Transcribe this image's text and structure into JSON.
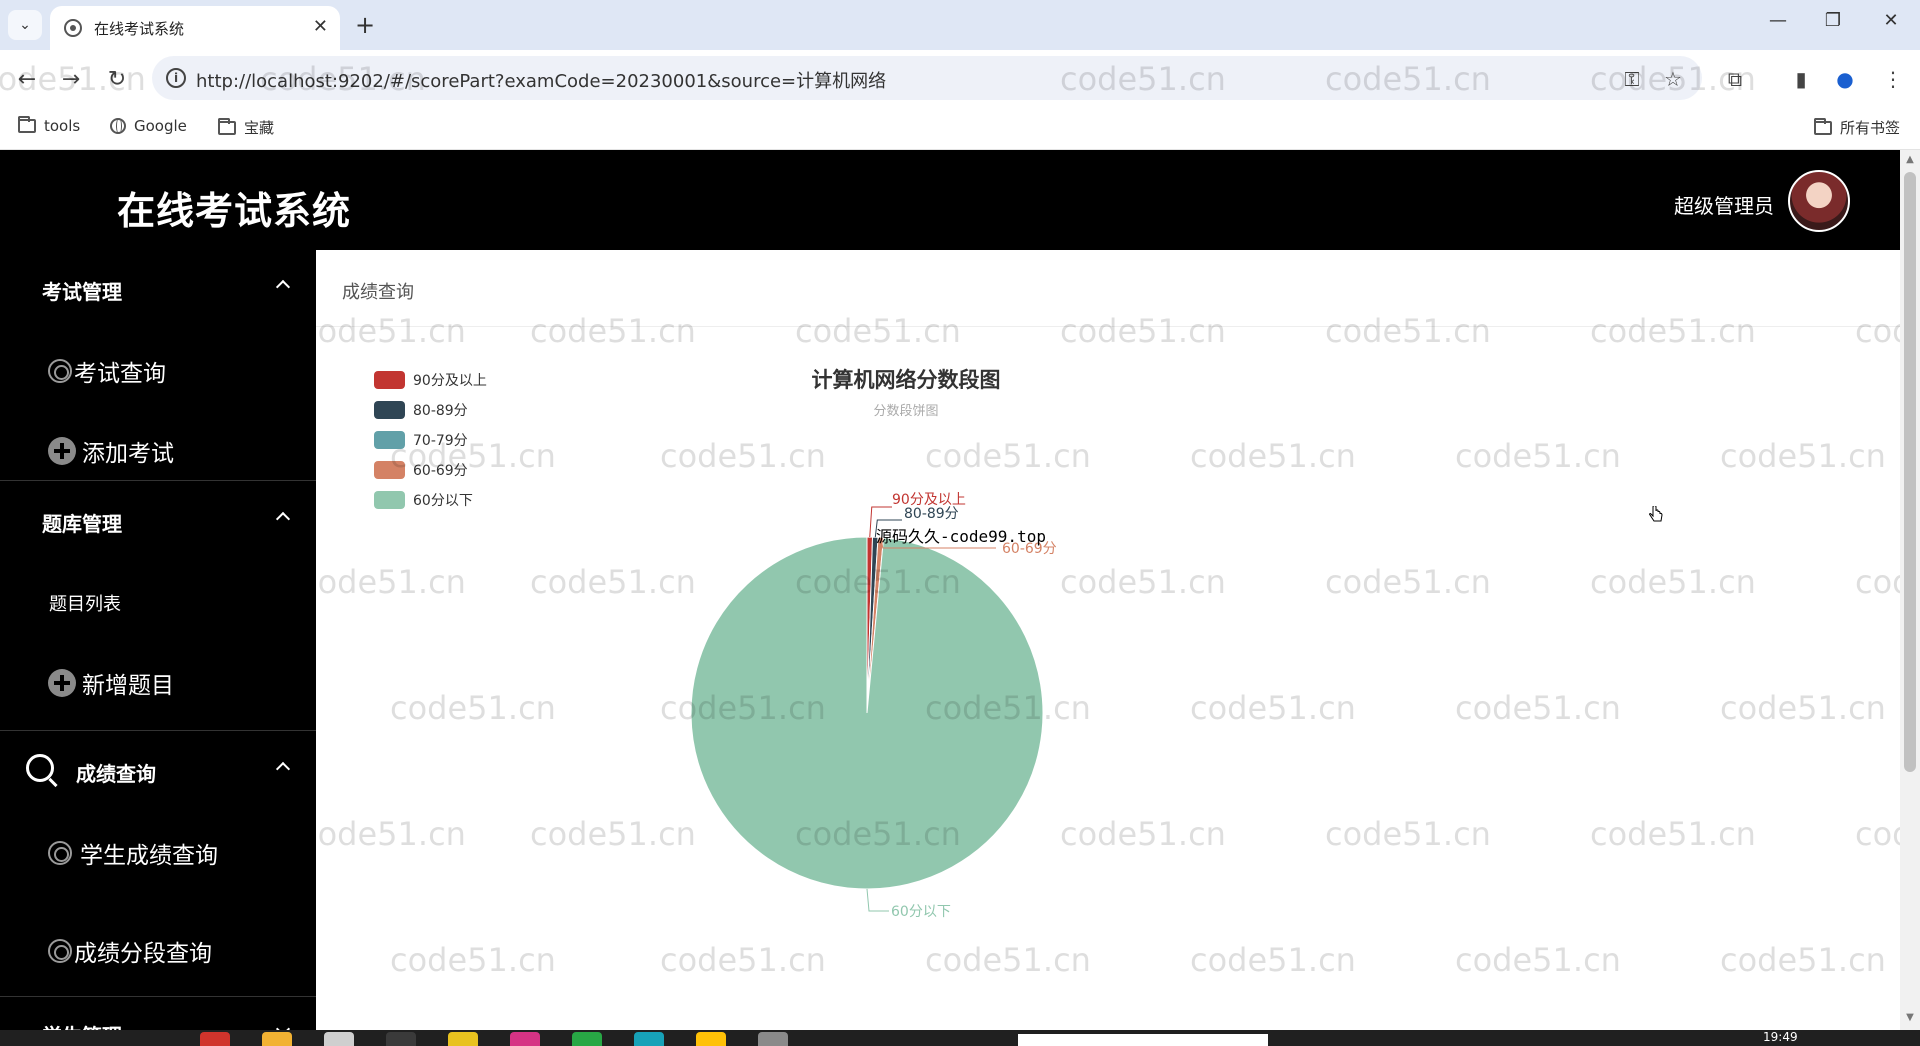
{
  "browser": {
    "tab_title": "在线考试系统",
    "url": "http://localhost:9202/#/scorePart?examCode=20230001&source=计算机网络",
    "bookmarks": [
      "tools",
      "Google",
      "宝藏"
    ],
    "all_bookmarks": "所有书签"
  },
  "header": {
    "app_title": "在线考试系统",
    "user_name": "超级管理员"
  },
  "sidebar": {
    "groups": [
      {
        "title": "考试管理",
        "items": [
          "考试查询",
          "添加考试"
        ]
      },
      {
        "title": "题库管理",
        "items": [
          "题目列表",
          "新增题目"
        ]
      },
      {
        "title": "成绩查询",
        "items": [
          "学生成绩查询",
          "成绩分段查询"
        ]
      },
      {
        "title": "学生管理"
      }
    ]
  },
  "main": {
    "breadcrumb": "成绩查询",
    "overlay_text": "源码久久-code99.top"
  },
  "chart_data": {
    "type": "pie",
    "title": "计算机网络分数段图",
    "subtitle": "分数段饼图",
    "legend_position": "top-left",
    "categories": [
      "90分及以上",
      "80-89分",
      "70-79分",
      "60-69分",
      "60分以下"
    ],
    "values": [
      0.5,
      0.5,
      0,
      0.5,
      98.5
    ],
    "colors": [
      "#c23531",
      "#2f4554",
      "#61a0a8",
      "#d48265",
      "#91c7ae"
    ],
    "label_bottom": "60分以下"
  },
  "watermark": "code51.cn",
  "taskbar": {
    "time": "19:49"
  }
}
